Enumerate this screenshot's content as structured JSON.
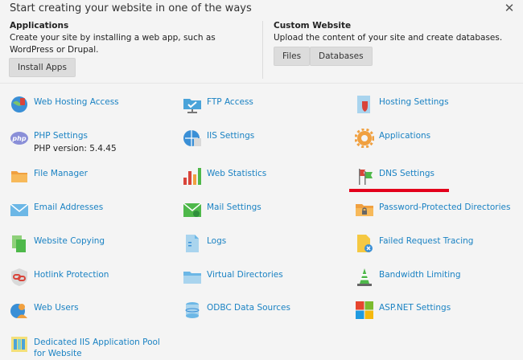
{
  "header": {
    "title": "Start creating your website in one of the ways",
    "close_symbol": "✕"
  },
  "applications": {
    "heading": "Applications",
    "description": "Create your site by installing a web app, such as WordPress or Drupal.",
    "button": "Install Apps"
  },
  "custom": {
    "heading": "Custom Website",
    "description": "Upload the content of your site and create databases.",
    "files_button": "Files",
    "databases_button": "Databases"
  },
  "tools": {
    "web_hosting_access": "Web Hosting Access",
    "ftp_access": "FTP Access",
    "hosting_settings": "Hosting Settings",
    "php_settings": "PHP Settings",
    "php_version": "PHP version: 5.4.45",
    "iis_settings": "IIS Settings",
    "applications": "Applications",
    "file_manager": "File Manager",
    "web_statistics": "Web Statistics",
    "dns_settings": "DNS Settings",
    "email_addresses": "Email Addresses",
    "mail_settings": "Mail Settings",
    "password_protected": "Password-Protected Directories",
    "website_copying": "Website Copying",
    "logs": "Logs",
    "failed_request_tracing": "Failed Request Tracing",
    "hotlink_protection": "Hotlink Protection",
    "virtual_directories": "Virtual Directories",
    "bandwidth_limiting": "Bandwidth Limiting",
    "web_users": "Web Users",
    "odbc_data_sources": "ODBC Data Sources",
    "aspnet_settings": "ASP.NET Settings",
    "dedicated_pool": "Dedicated IIS Application Pool for Website"
  },
  "php_icon_text": "php",
  "colors": {
    "link": "#1a82c3",
    "highlight": "#e3001b",
    "background": "#f4f4f4"
  }
}
